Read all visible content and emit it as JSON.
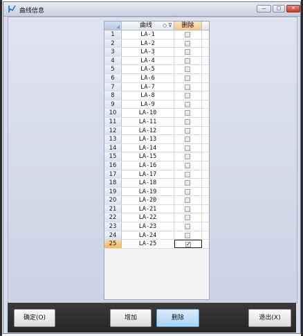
{
  "window": {
    "title": "曲线信息",
    "icon": "curve-app-icon",
    "controls": {
      "minimize": "—",
      "maximize": "□",
      "close": "✕"
    }
  },
  "grid": {
    "header": {
      "curve": "曲线",
      "delete": "删除",
      "sort_icon": "◇",
      "filter_icon": "⊽"
    },
    "rows": [
      {
        "num": "1",
        "name": "LA-1",
        "checked": false
      },
      {
        "num": "2",
        "name": "LA-2",
        "checked": false
      },
      {
        "num": "3",
        "name": "LA-3",
        "checked": false
      },
      {
        "num": "4",
        "name": "LA-4",
        "checked": false
      },
      {
        "num": "5",
        "name": "LA-5",
        "checked": false
      },
      {
        "num": "6",
        "name": "LA-6",
        "checked": false
      },
      {
        "num": "7",
        "name": "LA-7",
        "checked": false
      },
      {
        "num": "8",
        "name": "LA-8",
        "checked": false
      },
      {
        "num": "9",
        "name": "LA-9",
        "checked": false
      },
      {
        "num": "10",
        "name": "LA-10",
        "checked": false
      },
      {
        "num": "11",
        "name": "LA-11",
        "checked": false
      },
      {
        "num": "12",
        "name": "LA-12",
        "checked": false
      },
      {
        "num": "13",
        "name": "LA-13",
        "checked": false
      },
      {
        "num": "14",
        "name": "LA-14",
        "checked": false
      },
      {
        "num": "15",
        "name": "LA-15",
        "checked": false
      },
      {
        "num": "16",
        "name": "LA-16",
        "checked": false
      },
      {
        "num": "17",
        "name": "LA-17",
        "checked": false
      },
      {
        "num": "18",
        "name": "LA-18",
        "checked": false
      },
      {
        "num": "19",
        "name": "LA-19",
        "checked": false
      },
      {
        "num": "20",
        "name": "LA-20",
        "checked": false
      },
      {
        "num": "21",
        "name": "LA-21",
        "checked": false
      },
      {
        "num": "22",
        "name": "LA-22",
        "checked": false
      },
      {
        "num": "23",
        "name": "LA-23",
        "checked": false
      },
      {
        "num": "24",
        "name": "LA-24",
        "checked": false
      },
      {
        "num": "25",
        "name": "LA-25",
        "checked": true
      }
    ]
  },
  "buttons": {
    "ok": "确定(O)",
    "add": "增加",
    "delete": "删除",
    "exit": "退出(X)"
  },
  "colors": {
    "selected_row_header": "#f2b966",
    "delete_header": "#f5c987",
    "active_button": "#a9d3f4",
    "bottom_bar": "#2f2f2f"
  }
}
